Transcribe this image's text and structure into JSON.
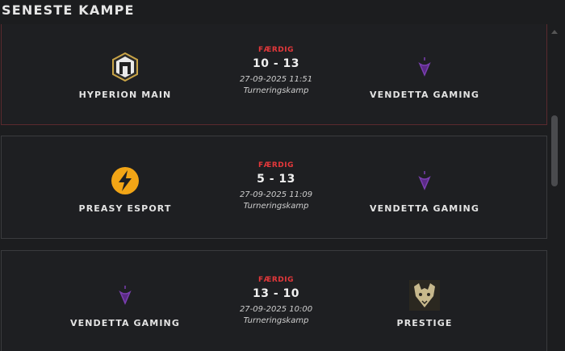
{
  "header": {
    "title": "SENESTE KAMPE"
  },
  "matches": [
    {
      "status": "FÆRDIG",
      "score": "10 - 13",
      "date": "27-09-2025 11:51",
      "type": "Turneringskamp",
      "home": {
        "name": "HYPERION MAIN",
        "logo": "hyperion-logo-icon"
      },
      "away": {
        "name": "VENDETTA GAMING",
        "logo": "vendetta-logo-icon"
      }
    },
    {
      "status": "FÆRDIG",
      "score": "5 - 13",
      "date": "27-09-2025 11:09",
      "type": "Turneringskamp",
      "home": {
        "name": "PREASY ESPORT",
        "logo": "preasy-logo-icon"
      },
      "away": {
        "name": "VENDETTA GAMING",
        "logo": "vendetta-logo-icon"
      }
    },
    {
      "status": "FÆRDIG",
      "score": "13 - 10",
      "date": "27-09-2025 10:00",
      "type": "Turneringskamp",
      "home": {
        "name": "VENDETTA GAMING",
        "logo": "vendetta-logo-icon"
      },
      "away": {
        "name": "PRESTIGE",
        "logo": "prestige-logo-icon"
      }
    }
  ],
  "colors": {
    "status": "#e5383b",
    "background": "#1c1d1f",
    "card_border": "#3a3b3e"
  }
}
